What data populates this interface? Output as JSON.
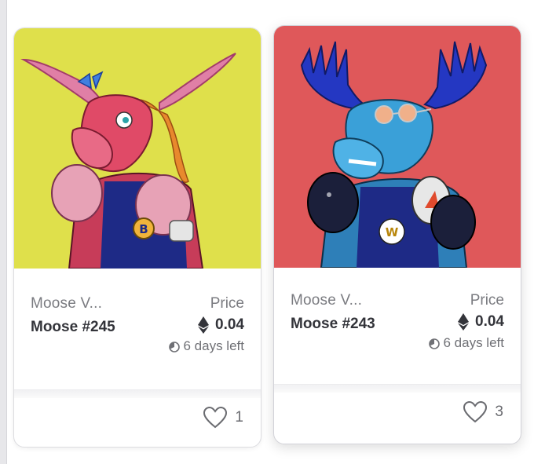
{
  "cards": [
    {
      "collection": "Moose V...",
      "name": "Moose #245",
      "price_label": "Price",
      "price": "0.04",
      "time_left": "6 days left",
      "likes": "1",
      "colors": {
        "background": "#dfe04b",
        "skin": "#e04a67",
        "antler": "#e07fa6",
        "shirt": "#1e2a86"
      }
    },
    {
      "collection": "Moose V...",
      "name": "Moose #243",
      "price_label": "Price",
      "price": "0.04",
      "time_left": "6 days left",
      "likes": "3",
      "colors": {
        "background": "#df585a",
        "skin": "#3aa0d8",
        "antler": "#2437c2",
        "shirt": "#1e2a86"
      }
    }
  ],
  "icons": {
    "currency": "ethereum-icon",
    "timer": "clock-icon",
    "favorite": "heart-icon"
  }
}
